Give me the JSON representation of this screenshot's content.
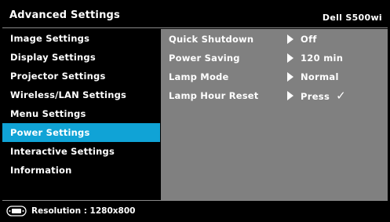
{
  "header": {
    "title": "Advanced Settings",
    "model": "Dell  S500wi"
  },
  "menu": {
    "items": [
      {
        "label": "Image Settings",
        "selected": false
      },
      {
        "label": "Display Settings",
        "selected": false
      },
      {
        "label": "Projector Settings",
        "selected": false
      },
      {
        "label": "Wireless/LAN Settings",
        "selected": false
      },
      {
        "label": "Menu Settings",
        "selected": false
      },
      {
        "label": "Power Settings",
        "selected": true
      },
      {
        "label": "Interactive Settings",
        "selected": false
      },
      {
        "label": "Information",
        "selected": false
      }
    ]
  },
  "panel": {
    "rows": [
      {
        "label": "Quick Shutdown",
        "value": "Off"
      },
      {
        "label": "Power Saving",
        "value": "120 min"
      },
      {
        "label": "Lamp Mode",
        "value": "Normal"
      },
      {
        "label": "Lamp Hour Reset",
        "value": "Press",
        "check": "✓"
      }
    ]
  },
  "status": {
    "icon": "input-source-icon",
    "text": "Resolution : 1280x800"
  },
  "colors": {
    "selected": "#10a3d6",
    "panel": "#808080",
    "background": "#000000"
  }
}
